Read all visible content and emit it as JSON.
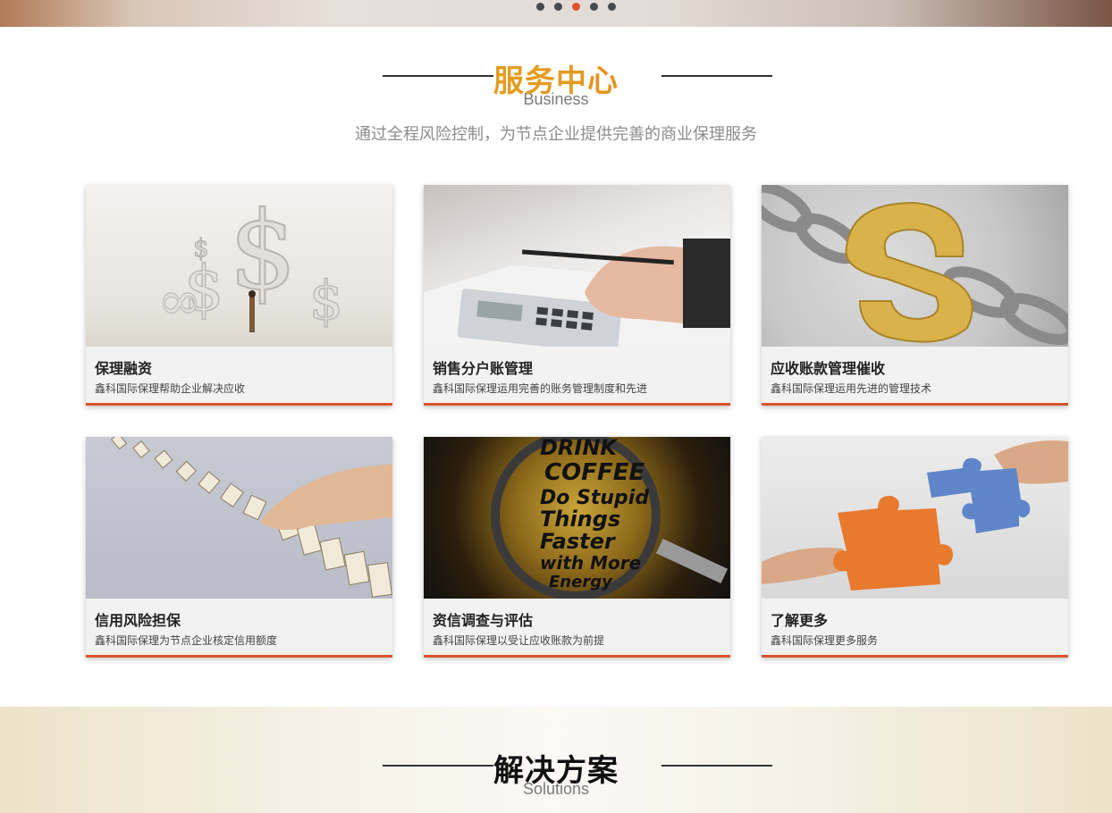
{
  "carousel": {
    "dots": 5,
    "active_index": 2
  },
  "business": {
    "title": "服务中心",
    "subtitle": "Business",
    "description": "通过全程风险控制，为节点企业提供完善的商业保理服务"
  },
  "cards": [
    {
      "title": "保理融资",
      "desc": "鑫科国际保理帮助企业解决应收",
      "image": "dollar-sculpture-image"
    },
    {
      "title": "销售分户账管理",
      "desc": "鑫科国际保理运用完善的账务管理制度和先进",
      "image": "calculator-hand-image"
    },
    {
      "title": "应收账款管理催收",
      "desc": "鑫科国际保理运用先进的管理技术",
      "image": "chain-dollar-image"
    },
    {
      "title": "信用风险担保",
      "desc": "鑫科国际保理为节点企业核定信用额度",
      "image": "dominoes-hand-image"
    },
    {
      "title": "资信调查与评估",
      "desc": "鑫科国际保理以受让应收账款为前提",
      "image": "magnifier-coffee-image"
    },
    {
      "title": "了解更多",
      "desc": "鑫科国际保理更多服务",
      "image": "puzzle-hands-image"
    }
  ],
  "solutions": {
    "title": "解决方案",
    "subtitle": "Solutions"
  },
  "colors": {
    "accent": "#d9542a",
    "gold": "#e49b20",
    "dot_active": "#e0522e"
  }
}
